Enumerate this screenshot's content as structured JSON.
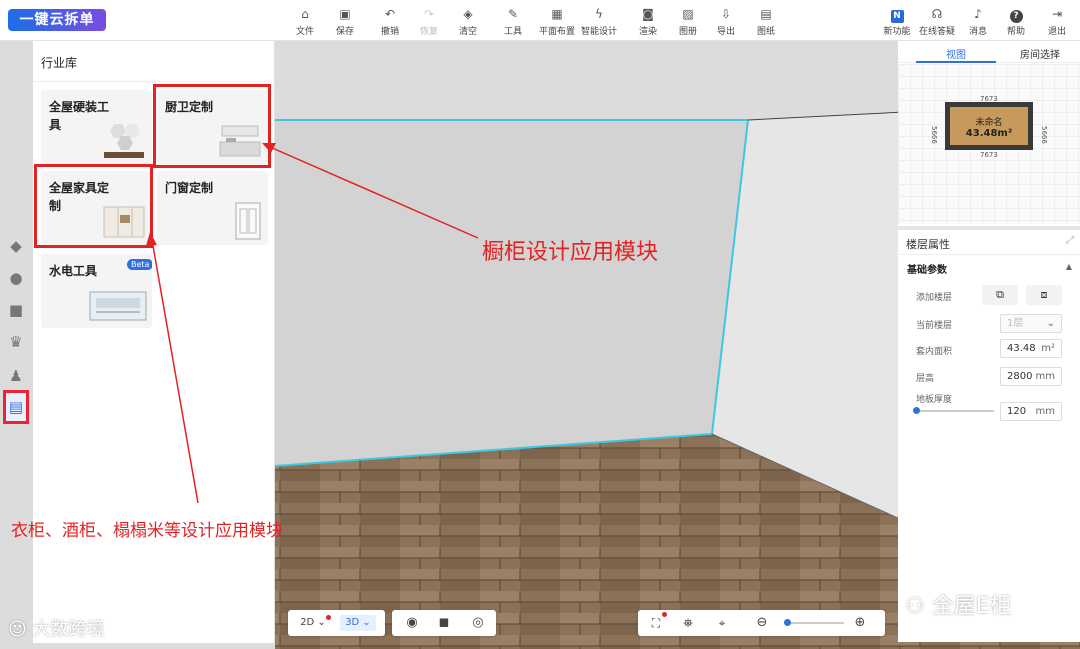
{
  "app": {
    "logo": "一键云拆单"
  },
  "toolbar": [
    {
      "label": "文件",
      "icon": "file-icon"
    },
    {
      "label": "保存",
      "icon": "save-icon"
    },
    {
      "label": "撤销",
      "icon": "undo-icon"
    },
    {
      "label": "恢复",
      "icon": "redo-icon"
    },
    {
      "label": "清空",
      "icon": "eraser-icon"
    },
    {
      "label": "工具",
      "icon": "wrench-icon"
    },
    {
      "label": "平面布置",
      "icon": "floorplan-icon"
    },
    {
      "label": "智能设计",
      "icon": "lightning-icon"
    },
    {
      "label": "渲染",
      "icon": "render-icon"
    },
    {
      "label": "图册",
      "icon": "album-icon"
    },
    {
      "label": "导出",
      "icon": "export-icon"
    },
    {
      "label": "图纸",
      "icon": "drawing-icon"
    }
  ],
  "toolbar_right": [
    {
      "label": "新功能",
      "icon": "new-feature-icon"
    },
    {
      "label": "在线答疑",
      "icon": "headset-icon"
    },
    {
      "label": "消息",
      "icon": "bell-icon"
    },
    {
      "label": "帮助",
      "icon": "help-icon"
    },
    {
      "label": "退出",
      "icon": "exit-icon"
    }
  ],
  "library": {
    "title": "行业库",
    "cards": [
      {
        "label": "全屋硬装工具"
      },
      {
        "label": "厨卫定制"
      },
      {
        "label": "全屋家具定制"
      },
      {
        "label": "门窗定制"
      },
      {
        "label": "水电工具",
        "badge": "Beta"
      }
    ]
  },
  "annotations": {
    "cabinet": "橱柜设计应用模块",
    "wardrobe": "衣柜、酒柜、榻榻米等设计应用模块"
  },
  "view_panel": {
    "tabs": [
      "视图",
      "房间选择"
    ],
    "room_name": "未命名",
    "room_area": "43.48m²",
    "dim_top": "7673",
    "dim_bottom": "7673",
    "dim_left": "5666",
    "dim_right": "5666"
  },
  "floor_props": {
    "title": "楼层属性",
    "section": "基础参数",
    "add_floor_label": "添加楼层",
    "current_floor_label": "当前楼层",
    "current_floor_value": "1层",
    "inner_area_label": "套内面积",
    "inner_area_value": "43.48",
    "inner_area_unit": "m²",
    "height_label": "层高",
    "height_value": "2800",
    "height_unit": "mm",
    "thickness_label": "地板厚度",
    "thickness_value": "120",
    "thickness_unit": "mm"
  },
  "bottom_bar": {
    "view_2d": "2D",
    "view_3d": "3D"
  },
  "watermarks": {
    "left": "大数跨境",
    "right": "全屋E柜"
  },
  "colors": {
    "accent": "#2f6fe0",
    "annotation": "#e32222",
    "wall_edge": "#3cc8e0"
  }
}
